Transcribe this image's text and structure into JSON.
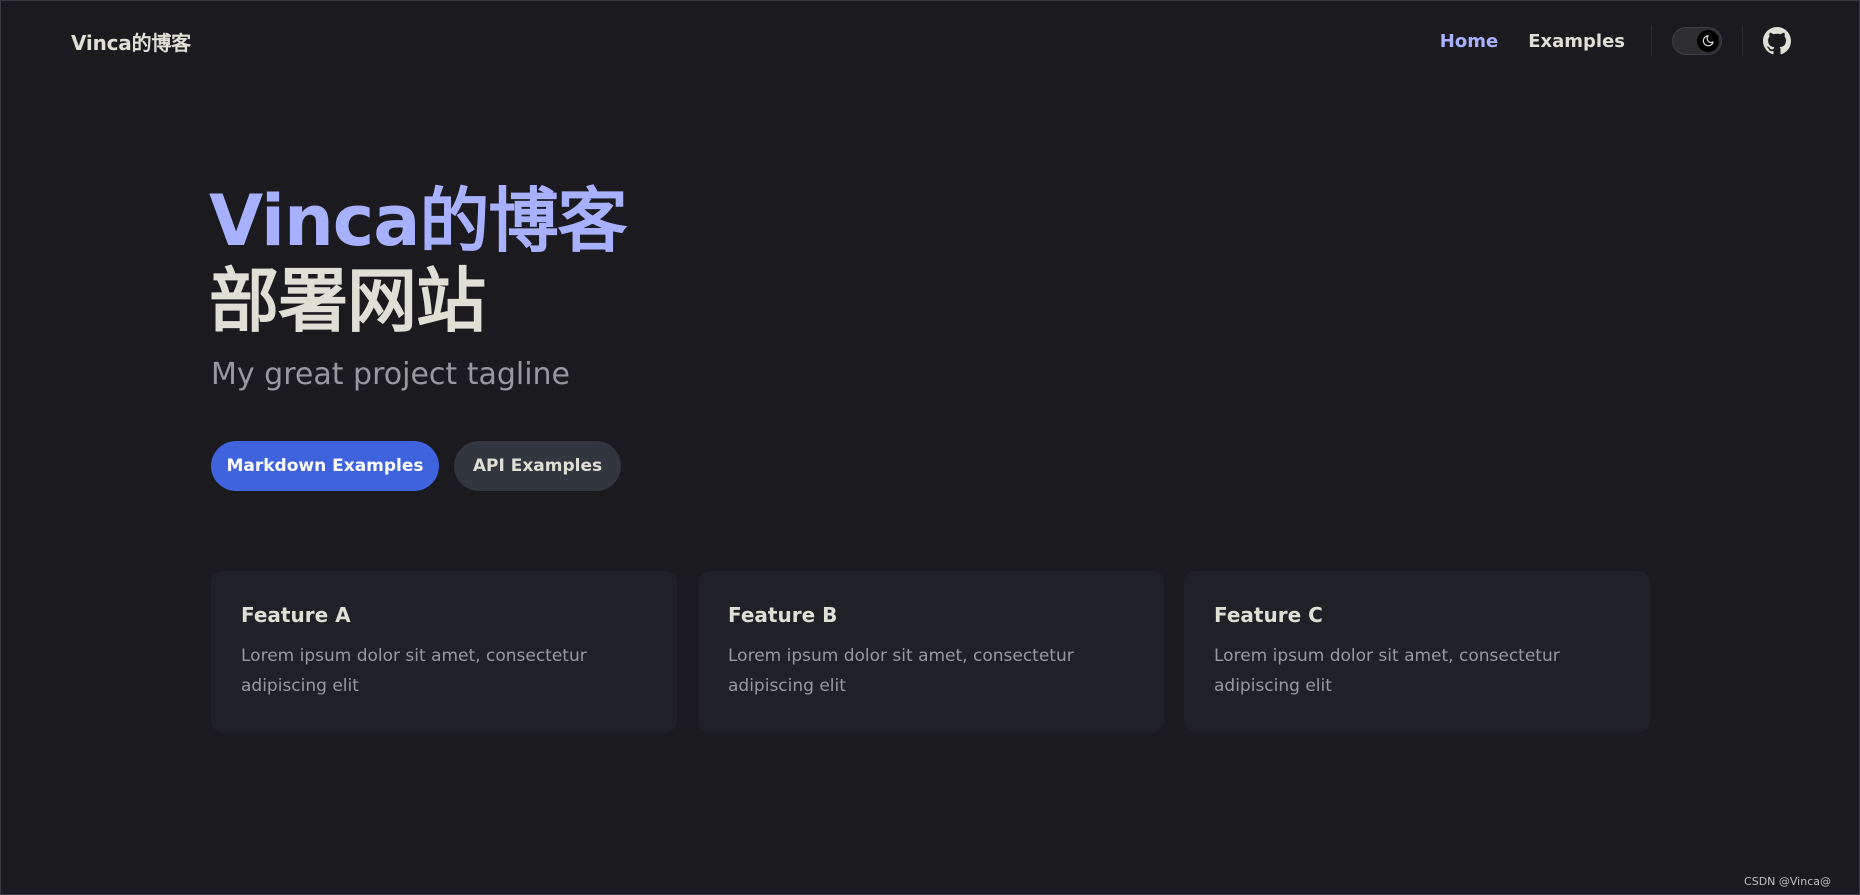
{
  "nav": {
    "logo": "Vinca的博客",
    "links": [
      {
        "label": "Home",
        "active": true
      },
      {
        "label": "Examples",
        "active": false
      }
    ],
    "theme_icon": "moon-icon",
    "social_icon": "github-icon"
  },
  "hero": {
    "name": "Vinca的博客",
    "text": "部署网站",
    "tagline": "My great project tagline",
    "actions": [
      {
        "label": "Markdown Examples",
        "theme": "brand"
      },
      {
        "label": "API Examples",
        "theme": "alt"
      }
    ]
  },
  "features": [
    {
      "title": "Feature A",
      "details": "Lorem ipsum dolor sit amet, consectetur adipiscing elit"
    },
    {
      "title": "Feature B",
      "details": "Lorem ipsum dolor sit amet, consectetur adipiscing elit"
    },
    {
      "title": "Feature C",
      "details": "Lorem ipsum dolor sit amet, consectetur adipiscing elit"
    }
  ],
  "watermark": "CSDN @Vinca@",
  "colors": {
    "background": "#1b1b1f",
    "brand": "#3e63dd",
    "brand_text": "#a8b1ff",
    "text": "#dfdfd6",
    "muted": "#98989f",
    "card": "#202127"
  }
}
